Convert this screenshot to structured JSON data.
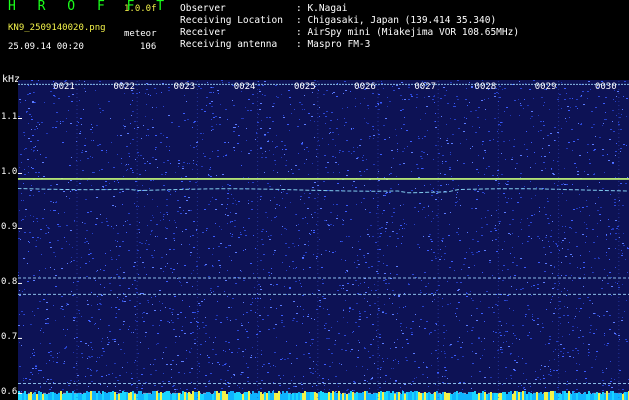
{
  "app": {
    "title": "H R O F F T",
    "version": "1.0.0f"
  },
  "file": {
    "name": "KN9_2509140020.png",
    "mode": "meteor",
    "datetime": "25.09.14 00:20",
    "count": "106"
  },
  "info": [
    {
      "label": "Observer",
      "value": ": K.Nagai"
    },
    {
      "label": "Receiving Location",
      "value": ": Chigasaki, Japan (139.414 35.340)"
    },
    {
      "label": "Receiver",
      "value": ": AirSpy mini (Miakejima VOR 108.65MHz)"
    },
    {
      "label": "Receiving antenna",
      "value": ": Maspro FM-3"
    }
  ],
  "axis": {
    "unit": "kHz",
    "y_ticks": [
      "1.1",
      "1.0",
      "0.9",
      "0.8",
      "0.7",
      "0.6"
    ],
    "y_range": [
      0.588,
      1.17
    ],
    "time_ticks": [
      "0021",
      "0022",
      "0023",
      "0024",
      "0025",
      "0026",
      "0027",
      "0028",
      "0029",
      "0030"
    ]
  },
  "signals": {
    "carrier_khz": 0.99,
    "lower_trace_khz": 0.97,
    "steady_lines_khz": [
      1.162,
      0.81,
      0.78,
      0.618,
      0.6
    ]
  },
  "colors": {
    "background": "#0d1255",
    "noise": "#2b47d6",
    "title": "#1bff1b",
    "highlight": "#f3f34a",
    "carrier": "#c9ff7a",
    "line": "#9fd9ff"
  }
}
